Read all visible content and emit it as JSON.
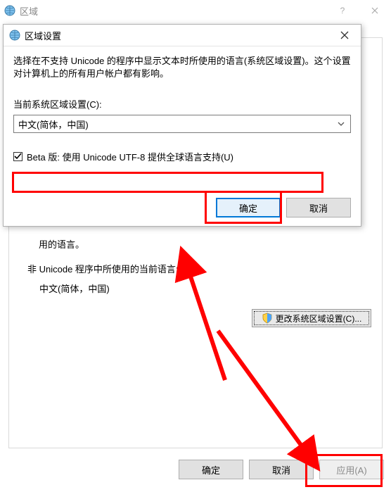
{
  "parent": {
    "title": "区域",
    "panel": {
      "line": "用的语言。",
      "section_title": "非 Unicode 程序中所使用的当前语言:",
      "current_lang": "中文(简体，中国)",
      "change_btn": "更改系统区域设置(C)..."
    },
    "buttons": {
      "ok": "确定",
      "cancel": "取消",
      "apply": "应用(A)"
    }
  },
  "dialog": {
    "title": "区域设置",
    "description": "选择在不支持 Unicode 的程序中显示文本时所使用的语言(系统区域设置)。这个设置对计算机上的所有用户帐户都有影响。",
    "label": "当前系统区域设置(C):",
    "combo_value": "中文(简体，中国)",
    "beta_checkbox": {
      "checked": true,
      "label": "Beta 版: 使用 Unicode UTF-8 提供全球语言支持(U)"
    },
    "buttons": {
      "ok": "确定",
      "cancel": "取消"
    }
  }
}
